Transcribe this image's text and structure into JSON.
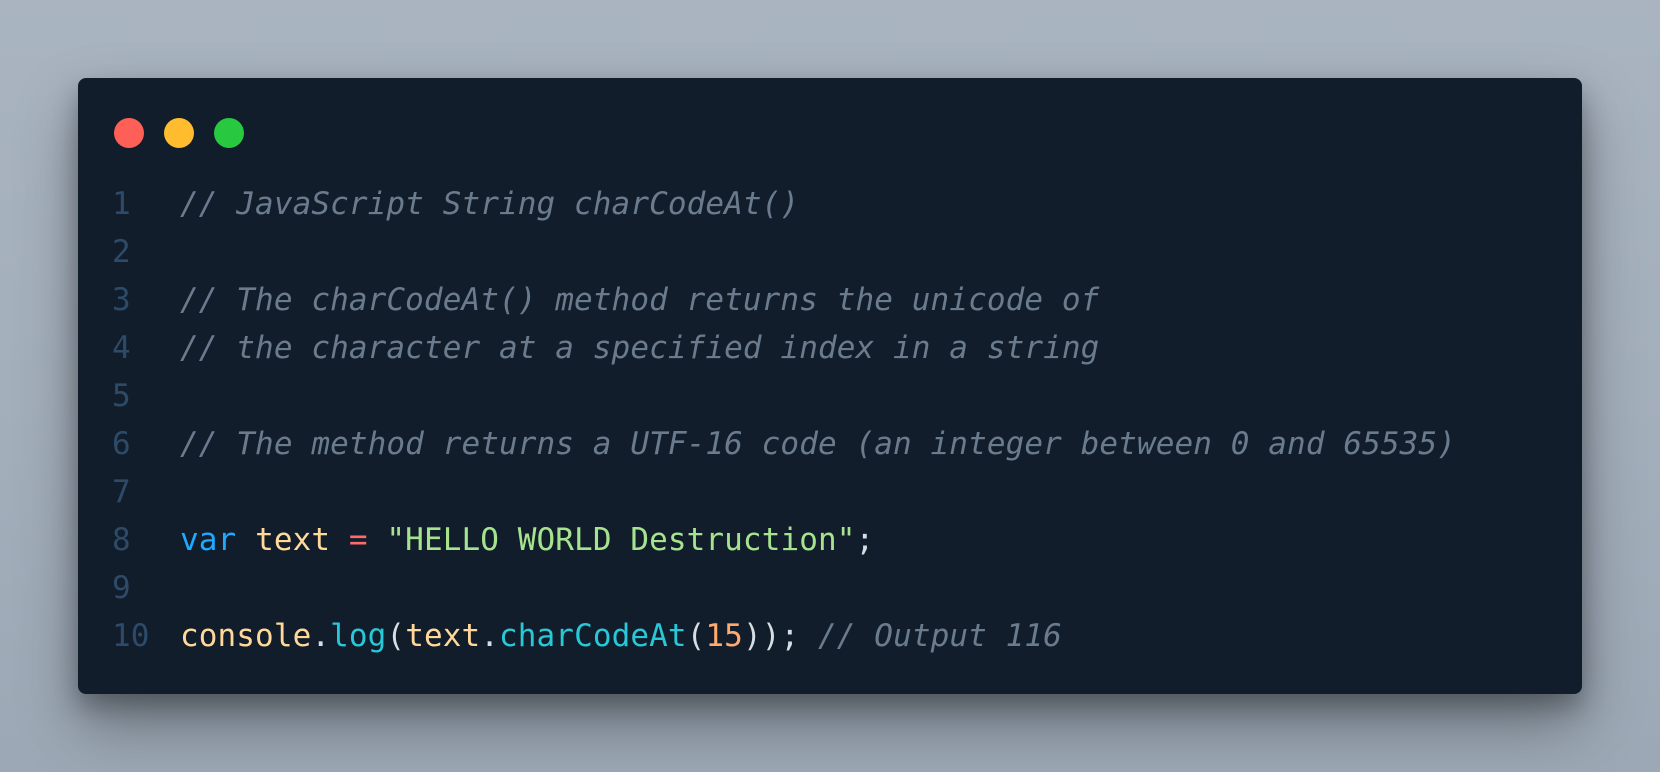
{
  "window": {
    "controls": {
      "close_color": "#fe5f57",
      "minimize_color": "#febc2e",
      "maximize_color": "#28c840"
    }
  },
  "code": {
    "lines": [
      {
        "number": "1",
        "comment": "// JavaScript String charCodeAt()"
      },
      {
        "number": "2"
      },
      {
        "number": "3",
        "comment": "// The charCodeAt() method returns the unicode of"
      },
      {
        "number": "4",
        "comment": "// the character at a specified index in a string"
      },
      {
        "number": "5"
      },
      {
        "number": "6",
        "comment": "// The method returns a UTF-16 code (an integer between 0 and 65535)"
      },
      {
        "number": "7"
      },
      {
        "number": "8",
        "keyword": "var",
        "identifier": "text",
        "operator": "=",
        "string": "\"HELLO WORLD Destruction\"",
        "semicolon": ";"
      },
      {
        "number": "9"
      },
      {
        "number": "10",
        "object": "console",
        "dot1": ".",
        "method1": "log",
        "paren_open1": "(",
        "identifier": "text",
        "dot2": ".",
        "method2": "charCodeAt",
        "paren_open2": "(",
        "number_literal": "15",
        "paren_close": "));",
        "comment": "// Output 116"
      }
    ]
  }
}
